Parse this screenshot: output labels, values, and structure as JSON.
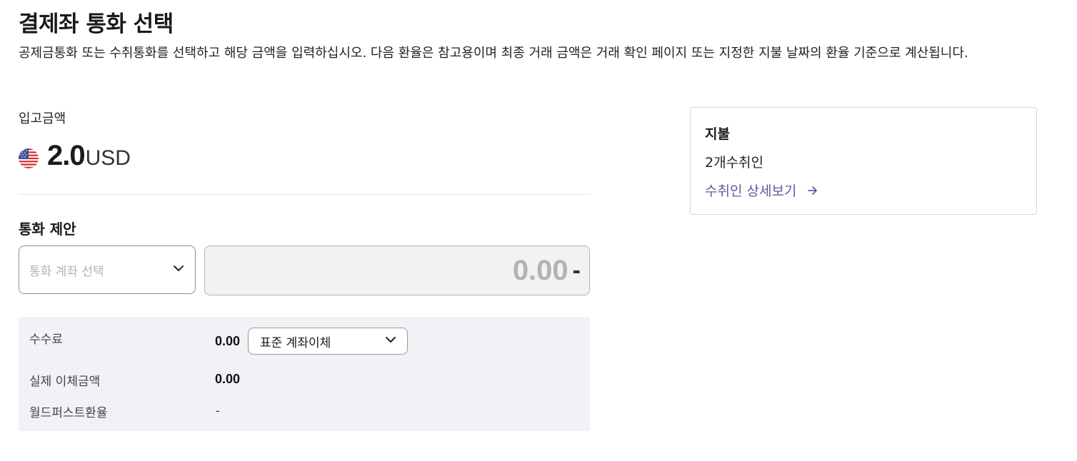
{
  "header": {
    "title": "결제좌 통화 선택",
    "description": "공제금통화 또는 수취통화를 선택하고 해당 금액을 입력하십시오. 다음 환율은 참고용이며 최종 거래 금액은 거래 확인 페이지 또는 지정한 지불 날짜의 환율 기준으로 계산됩니다."
  },
  "deposit": {
    "label": "입고금액",
    "amount": "2.0",
    "currency": "USD",
    "flag_icon": "us-flag-icon"
  },
  "currency_proposal": {
    "title": "통화 제안",
    "select_placeholder": "통화 계좌 선택",
    "amount_value": "0.00",
    "amount_currency": "-"
  },
  "fees": {
    "fee_label": "수수료",
    "fee_value": "0.00",
    "transfer_type": "표준 계좌이체",
    "actual_label": "실제 이체금액",
    "actual_value": "0.00",
    "rate_label": "월드퍼스트환율",
    "rate_value": "-"
  },
  "payment_card": {
    "title": "지불",
    "recipient_count": "2개수취인",
    "details_link": "수취인 상세보기"
  },
  "colors": {
    "link": "#5a5aa8",
    "panel_bg": "#f2f2f6",
    "input_disabled_bg": "#f2f2f2"
  }
}
